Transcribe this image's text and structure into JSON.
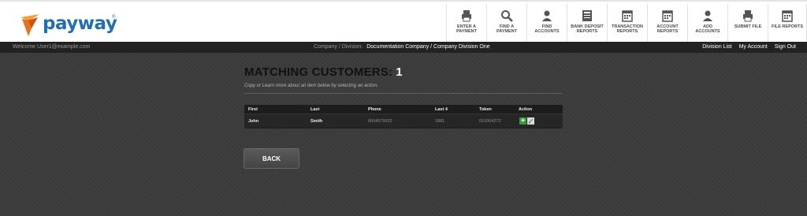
{
  "brand": {
    "name": "payway",
    "trademark": "®"
  },
  "nav": [
    {
      "label": "ENTER A PAYMENT",
      "icon": "printer-icon"
    },
    {
      "label": "FIND A PAYMENT",
      "icon": "search-icon"
    },
    {
      "label": "FIND ACCOUNTS",
      "icon": "user-icon"
    },
    {
      "label": "BANK DEPOSIT REPORTS",
      "icon": "document-icon"
    },
    {
      "label": "TRANSACTION REPORTS",
      "icon": "calendar-icon"
    },
    {
      "label": "ACCOUNT REPORTS",
      "icon": "calendar-icon"
    },
    {
      "label": "ADD ACCOUNTS",
      "icon": "user-icon"
    },
    {
      "label": "SUBMIT FILE",
      "icon": "printer-icon"
    },
    {
      "label": "FILE REPORTS",
      "icon": "calendar-icon"
    }
  ],
  "subbar": {
    "welcome": "Welcome User1@example.com",
    "company_label": "Company / Division:",
    "company_value": "Documentation Company / Company Division One",
    "links": [
      "Division List",
      "My Account",
      "Sign Out"
    ]
  },
  "main": {
    "title": "MATCHING CUSTOMERS:",
    "count": "1",
    "hint": "Copy or Learn more about an item below by selecting an action.",
    "back_label": "BACK"
  },
  "table": {
    "columns": [
      "First",
      "Last",
      "Phone",
      "Last 4",
      "Token",
      "Action"
    ],
    "rows": [
      {
        "first": "John",
        "last": "Smith",
        "phone": "8004579932",
        "last4": "1881",
        "token": "010004272"
      }
    ]
  },
  "colors": {
    "brand_blue": "#1f6fb7",
    "brand_orange": "#f08a1c",
    "add_green": "#2f9d38"
  }
}
